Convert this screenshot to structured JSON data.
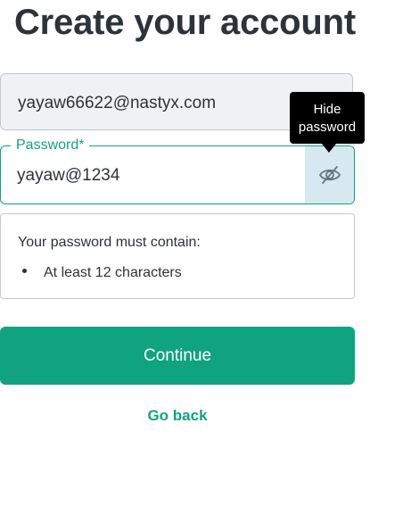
{
  "page": {
    "title": "Create your account"
  },
  "form": {
    "email": {
      "value": "yayaw66622@nastyx.com"
    },
    "password": {
      "label": "Password*",
      "value": "yayaw@1234",
      "toggle_icon": "eye-slash-icon",
      "tooltip_line1": "Hide",
      "tooltip_line2": "password"
    },
    "requirements": {
      "heading": "Your password must contain:",
      "items": [
        "At least 12 characters"
      ]
    },
    "continue_label": "Continue",
    "go_back_label": "Go back"
  },
  "colors": {
    "accent": "#10a37f",
    "text": "#2d333a",
    "email_field_bg": "#f0f1f3",
    "toggle_bg": "#d7e8f0",
    "tooltip_bg": "#000000"
  }
}
